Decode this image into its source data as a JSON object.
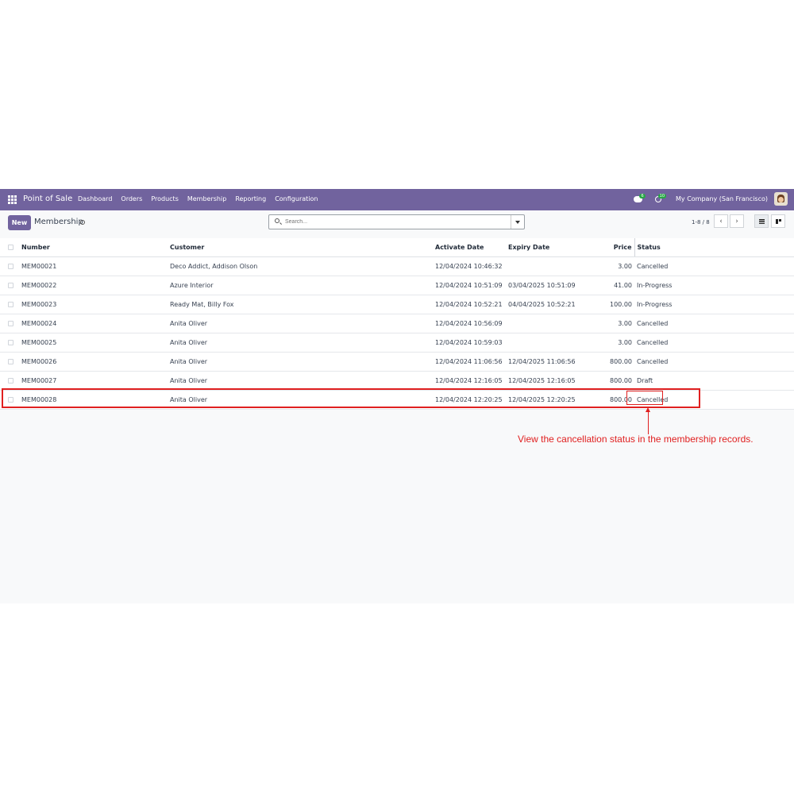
{
  "navbar": {
    "app_name": "Point of Sale",
    "menu": [
      "Dashboard",
      "Orders",
      "Products",
      "Membership",
      "Reporting",
      "Configuration"
    ],
    "chat_count": "6",
    "activity_count": "10",
    "company": "My Company (San Francisco)"
  },
  "control": {
    "new_label": "New",
    "breadcrumb": "Membership",
    "search_placeholder": "Search...",
    "pager": "1-8 / 8"
  },
  "table": {
    "headers": {
      "number": "Number",
      "customer": "Customer",
      "activate": "Activate Date",
      "expiry": "Expiry Date",
      "price": "Price",
      "status": "Status"
    },
    "rows": [
      {
        "number": "MEM00021",
        "customer": "Deco Addict, Addison Olson",
        "activate": "12/04/2024 10:46:32",
        "expiry": "",
        "price": "3.00",
        "status": "Cancelled"
      },
      {
        "number": "MEM00022",
        "customer": "Azure Interior",
        "activate": "12/04/2024 10:51:09",
        "expiry": "03/04/2025 10:51:09",
        "price": "41.00",
        "status": "In-Progress"
      },
      {
        "number": "MEM00023",
        "customer": "Ready Mat, Billy Fox",
        "activate": "12/04/2024 10:52:21",
        "expiry": "04/04/2025 10:52:21",
        "price": "100.00",
        "status": "In-Progress"
      },
      {
        "number": "MEM00024",
        "customer": "Anita Oliver",
        "activate": "12/04/2024 10:56:09",
        "expiry": "",
        "price": "3.00",
        "status": "Cancelled"
      },
      {
        "number": "MEM00025",
        "customer": "Anita Oliver",
        "activate": "12/04/2024 10:59:03",
        "expiry": "",
        "price": "3.00",
        "status": "Cancelled"
      },
      {
        "number": "MEM00026",
        "customer": "Anita Oliver",
        "activate": "12/04/2024 11:06:56",
        "expiry": "12/04/2025 11:06:56",
        "price": "800.00",
        "status": "Cancelled"
      },
      {
        "number": "MEM00027",
        "customer": "Anita Oliver",
        "activate": "12/04/2024 12:16:05",
        "expiry": "12/04/2025 12:16:05",
        "price": "800.00",
        "status": "Draft"
      },
      {
        "number": "MEM00028",
        "customer": "Anita Oliver",
        "activate": "12/04/2024 12:20:25",
        "expiry": "12/04/2025 12:20:25",
        "price": "800.00",
        "status": "Cancelled"
      }
    ]
  },
  "annotation": {
    "text": "View the cancellation status in the membership records."
  },
  "colors": {
    "brand": "#71639e",
    "annotation": "#e02020"
  }
}
